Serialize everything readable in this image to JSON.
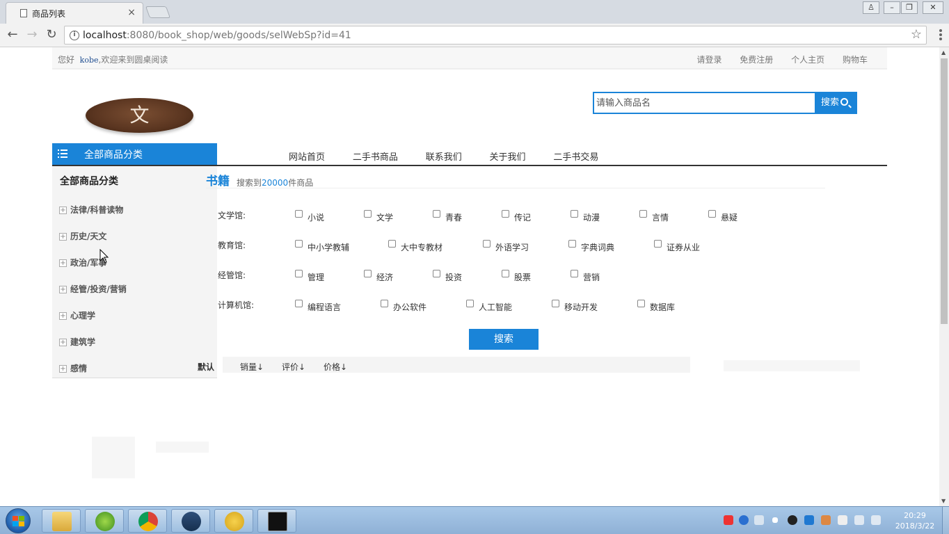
{
  "browser": {
    "tab_title": "商品列表",
    "tab_close": "×",
    "url_host": "localhost",
    "url_rest": ":8080/book_shop/web/goods/selWebSp?id=41",
    "info_glyph": "i",
    "star_glyph": "☆",
    "back_glyph": "←",
    "forward_glyph": "→",
    "reload_glyph": "↻",
    "win_user_glyph": "♙",
    "win_min_glyph": "–",
    "win_max_glyph": "❐",
    "win_close_glyph": "✕"
  },
  "topbar": {
    "greeting_prefix": "您好",
    "username": "kobe",
    "greeting_suffix": ",欢迎来到圆桌阅读",
    "links": [
      "请登录",
      "免费注册",
      "个人主页",
      "购物车"
    ]
  },
  "logo": {
    "glyph": "文"
  },
  "search": {
    "placeholder": "请输入商品名",
    "button_label": "搜索"
  },
  "category_bar": {
    "label": "全部商品分类"
  },
  "main_nav": [
    "网站首页",
    "二手书商品",
    "联系我们",
    "关于我们",
    "二手书交易"
  ],
  "sidebar": {
    "title": "全部商品分类",
    "expand_glyph": "+",
    "items": [
      "法律/科普读物",
      "历史/天文",
      "政治/军事",
      "经管/投资/营销",
      "心理学",
      "建筑学",
      "感情"
    ]
  },
  "books": {
    "heading": "书籍",
    "count_prefix": "搜索到",
    "count": "20000",
    "count_suffix": "件商品"
  },
  "filters": [
    {
      "category": "文学馆:",
      "options": [
        "小说",
        "文学",
        "青春",
        "传记",
        "动漫",
        "言情",
        "悬疑"
      ]
    },
    {
      "category": "教育馆:",
      "options": [
        "中小学教辅",
        "大中专教材",
        "外语学习",
        "字典词典",
        "证券从业"
      ]
    },
    {
      "category": "经管馆:",
      "options": [
        "管理",
        "经济",
        "投资",
        "股票",
        "营销"
      ]
    },
    {
      "category": "计算机馆:",
      "options": [
        "编程语言",
        "办公软件",
        "人工智能",
        "移动开发",
        "数据库"
      ]
    }
  ],
  "filter_button": "搜索",
  "sort": {
    "default": "默认",
    "options": [
      "销量↓",
      "评价↓",
      "价格↓"
    ]
  },
  "clock": {
    "time": "20:29",
    "date": "2018/3/22"
  },
  "colors": {
    "accent": "#1a84d8",
    "nav_line": "#333333"
  }
}
